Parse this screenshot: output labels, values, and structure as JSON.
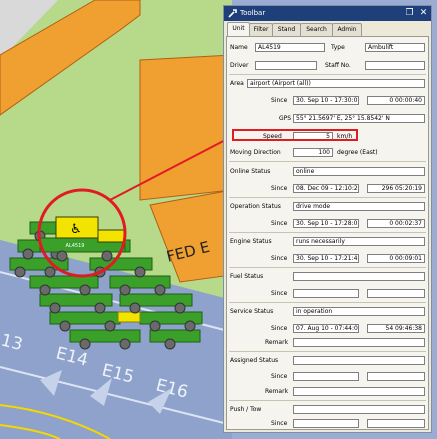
{
  "window": {
    "title": "Toolbar"
  },
  "tabs": [
    {
      "label": "Unit",
      "active": true
    },
    {
      "label": "Filter",
      "active": false
    },
    {
      "label": "Stand",
      "active": false
    },
    {
      "label": "Search",
      "active": false
    },
    {
      "label": "Admin",
      "active": false
    }
  ],
  "unit": {
    "name_label": "Name",
    "name": "AL4519",
    "type_label": "Type",
    "type": "Ambulift",
    "driver_label": "Driver",
    "driver": "",
    "staff_label": "Staff No.",
    "staff": "",
    "area_label": "Area",
    "area": "airport (Airport (all))",
    "since_label": "Since",
    "area_since": "30. Sep 10 - 17:30:0",
    "area_duration": "0 00:00:40",
    "gps_label": "GPS",
    "gps": "55° 21.5697' E, 25° 15.8542' N",
    "speed_label": "Speed",
    "speed": "5",
    "speed_unit": "km/h",
    "direction_label": "Moving Direction",
    "direction": "100",
    "direction_unit": "degree (East)",
    "online_label": "Online Status",
    "online": "online",
    "online_since": "08. Dec 09 - 12:10:2",
    "online_duration": "296 05:20:19",
    "operation_label": "Operation Status",
    "operation": "drive mode",
    "operation_since": "30. Sep 10 - 17:28:0",
    "operation_duration": "0 00:02:37",
    "engine_label": "Engine Status",
    "engine": "runs necessarily",
    "engine_since": "30. Sep 10 - 17:21:4",
    "engine_duration": "0 00:09:01",
    "fuel_label": "Fuel Status",
    "service_label": "Service Status",
    "service": "in operation",
    "service_since": "07. Aug 10 - 07:44:0",
    "service_duration": "54 09:46:38",
    "remark_label": "Remark",
    "assigned_label": "Assigned Status",
    "push_label": "Push / Tow"
  },
  "map": {
    "building_label": "FED E",
    "stands": [
      "13",
      "E14",
      "E15",
      "E16"
    ],
    "vehicle_label": "AL4519",
    "vehicle_icon": "wheelchair-icon",
    "colors": {
      "grass": "#b7d98a",
      "building": "#f0a030",
      "apron": "#8ea2cc",
      "vehicle": "#3aa02a",
      "highlight": "#e01b24",
      "vehicle_selected": "#f2e400"
    }
  }
}
